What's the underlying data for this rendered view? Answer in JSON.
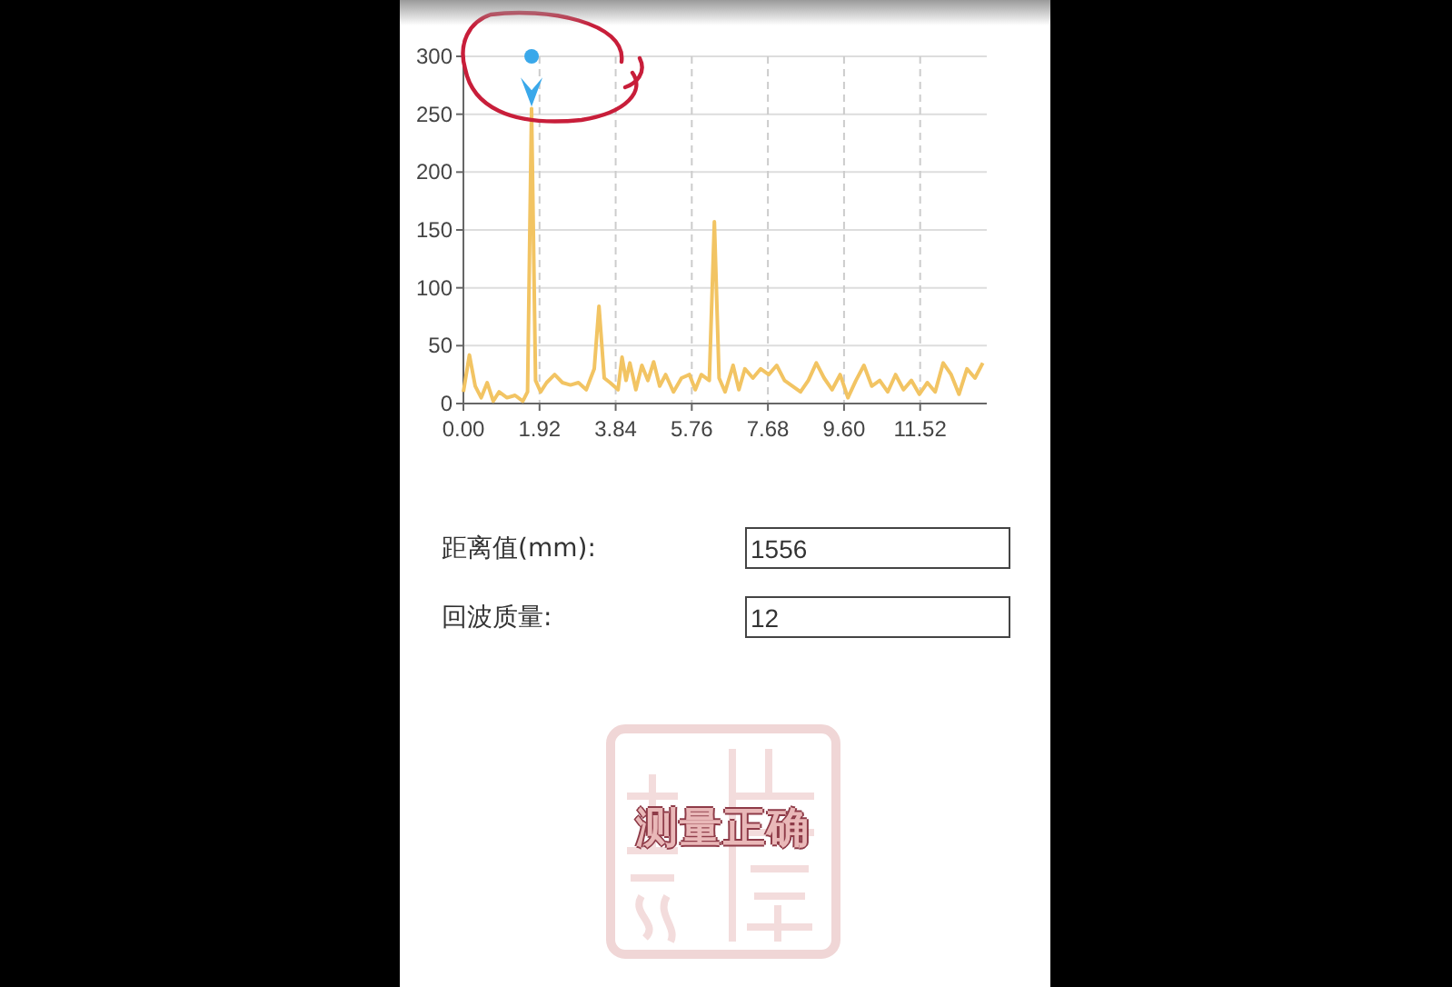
{
  "chart": {
    "chart_data": {
      "type": "line",
      "xlim": [
        0,
        13.2
      ],
      "ylim": [
        0,
        300
      ],
      "xticks": [
        {
          "value": 0,
          "label": "0.00"
        },
        {
          "value": 1.92,
          "label": "1.92"
        },
        {
          "value": 3.84,
          "label": "3.84"
        },
        {
          "value": 5.76,
          "label": "5.76"
        },
        {
          "value": 7.68,
          "label": "7.68"
        },
        {
          "value": 9.6,
          "label": "9.60"
        },
        {
          "value": 11.52,
          "label": "11.52"
        }
      ],
      "yticks": [
        0,
        50,
        100,
        150,
        200,
        250,
        300
      ],
      "x": [
        0,
        0.15,
        0.3,
        0.45,
        0.6,
        0.75,
        0.9,
        1.1,
        1.3,
        1.5,
        1.62,
        1.72,
        1.82,
        1.95,
        2.1,
        2.3,
        2.5,
        2.7,
        2.9,
        3.1,
        3.3,
        3.42,
        3.55,
        3.7,
        3.9,
        4.0,
        4.1,
        4.2,
        4.35,
        4.5,
        4.65,
        4.8,
        4.95,
        5.1,
        5.3,
        5.5,
        5.7,
        5.85,
        6.0,
        6.2,
        6.33,
        6.45,
        6.6,
        6.8,
        6.95,
        7.1,
        7.3,
        7.5,
        7.7,
        7.9,
        8.1,
        8.3,
        8.5,
        8.7,
        8.9,
        9.1,
        9.3,
        9.5,
        9.7,
        9.9,
        10.1,
        10.3,
        10.5,
        10.7,
        10.9,
        11.1,
        11.3,
        11.5,
        11.7,
        11.9,
        12.1,
        12.3,
        12.5,
        12.7,
        12.9,
        13.1
      ],
      "series": [
        {
          "color": "#f2c463",
          "values": [
            10,
            42,
            15,
            5,
            18,
            2,
            10,
            5,
            7,
            2,
            10,
            255,
            20,
            10,
            18,
            25,
            18,
            16,
            18,
            12,
            30,
            84,
            22,
            18,
            12,
            40,
            20,
            35,
            12,
            33,
            20,
            36,
            15,
            25,
            10,
            22,
            25,
            12,
            25,
            20,
            157,
            22,
            10,
            33,
            12,
            30,
            22,
            30,
            25,
            33,
            20,
            15,
            10,
            20,
            35,
            22,
            12,
            25,
            5,
            20,
            33,
            15,
            20,
            10,
            25,
            12,
            20,
            8,
            18,
            10,
            35,
            25,
            8,
            30,
            22,
            35
          ]
        }
      ],
      "grid": true
    }
  },
  "fields": [
    {
      "label": "距离值(mm):",
      "value": "1556"
    },
    {
      "label": "回波质量:",
      "value": "12"
    }
  ],
  "stamp": {
    "text": "测量正确"
  }
}
